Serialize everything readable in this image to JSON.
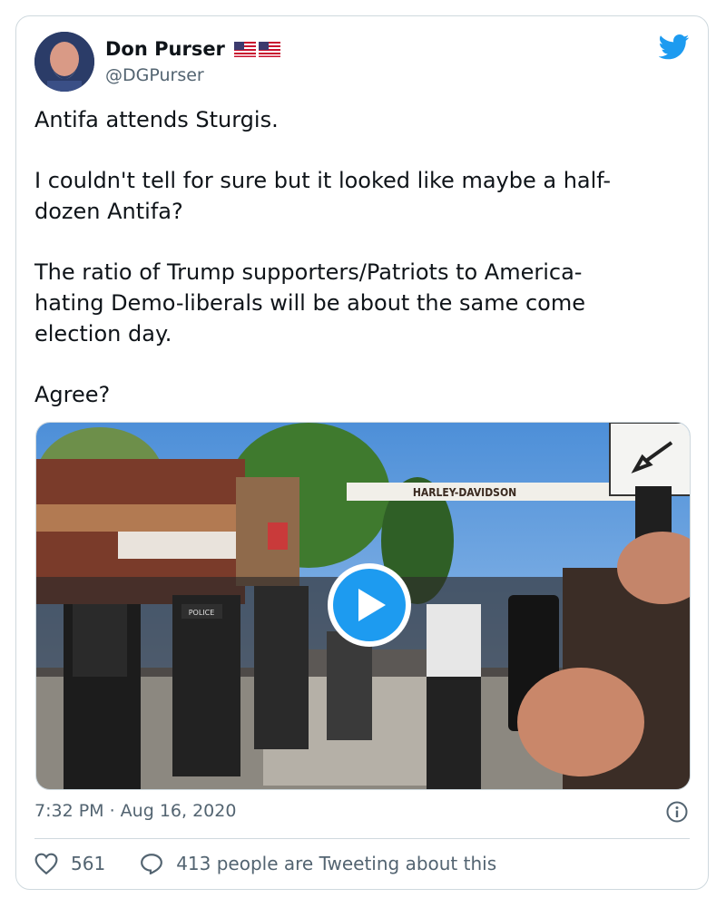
{
  "author": {
    "name": "Don Purser",
    "handle": "@DGPurser",
    "flag_count": 2
  },
  "tweet": {
    "paragraphs": [
      "Antifa attends Sturgis.",
      "I couldn't tell for sure but it looked like maybe a half-\ndozen Antifa?",
      "The ratio of Trump supporters/Patriots to America-\nhating Demo-liberals will be about the same come\nelection day.",
      "Agree?"
    ]
  },
  "media": {
    "banner_text": "HARLEY-DAVIDSON",
    "badge_text": "POLICE"
  },
  "meta": {
    "timestamp": "7:32 PM · Aug 16, 2020"
  },
  "actions": {
    "like_count": "561",
    "conversation_label": "413 people are Tweeting about this"
  },
  "colors": {
    "accent": "#1d9bf0",
    "text": "#0f1419",
    "secondary": "#536471",
    "border": "#cfd9de"
  },
  "icons": {
    "brand": "twitter-bird-icon",
    "play": "play-icon",
    "info": "info-icon",
    "like": "heart-icon",
    "reply": "speech-bubble-icon"
  }
}
